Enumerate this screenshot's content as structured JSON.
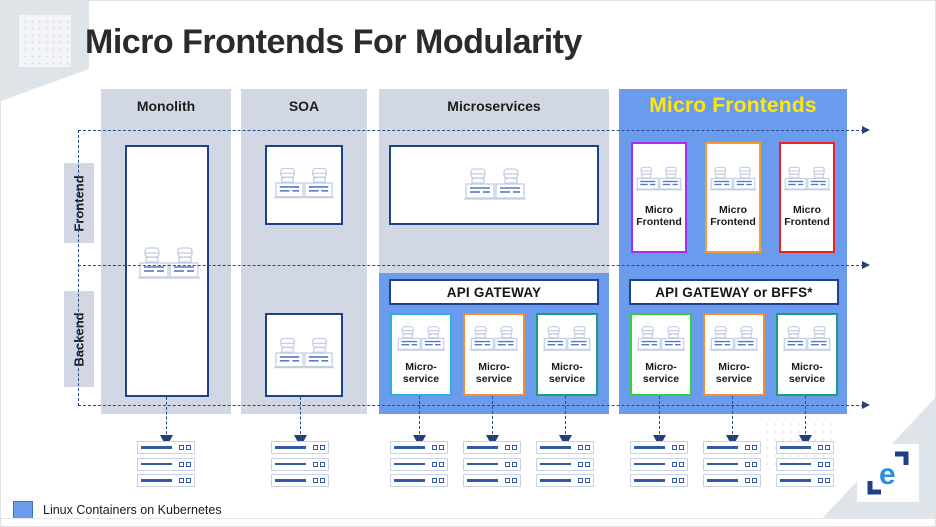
{
  "slide": {
    "title": "Micro Frontends For Modularity",
    "logo_name": "e-logo"
  },
  "bands": [
    {
      "label": "Frontend"
    },
    {
      "label": "Backend"
    }
  ],
  "columns": [
    {
      "id": "monolith",
      "header": "Monolith",
      "highlight": false,
      "frontend_boxes": [],
      "gateway": null,
      "services": []
    },
    {
      "id": "soa",
      "header": "SOA",
      "highlight": false,
      "frontend_boxes": [],
      "gateway": null,
      "services": []
    },
    {
      "id": "microservices",
      "header": "Microservices",
      "highlight": false,
      "frontend_boxes": [],
      "gateway": "API GATEWAY",
      "services": [
        {
          "label": "Micro-\nservice",
          "border": "#2ab0e8"
        },
        {
          "label": "Micro-\nservice",
          "border": "#f09030"
        },
        {
          "label": "Micro-\nservice",
          "border": "#1a9e76"
        }
      ]
    },
    {
      "id": "micro-frontends",
      "header": "Micro Frontends",
      "highlight": true,
      "frontend_boxes": [
        {
          "line1": "Micro",
          "line2": "Frontend",
          "border": "#a531f0"
        },
        {
          "line1": "Micro",
          "line2": "Frontend",
          "border": "#f0a030"
        },
        {
          "line1": "Micro",
          "line2": "Frontend",
          "border": "#f02020"
        }
      ],
      "gateway": "API GATEWAY or  BFFS*",
      "services": [
        {
          "label": "Micro-\nservice",
          "border": "#2fd43a"
        },
        {
          "label": "Micro-\nservice",
          "border": "#f09030"
        },
        {
          "line": "",
          "label": "Micro-\nservice",
          "border": "#1a9e76"
        }
      ]
    }
  ],
  "service_label": "Micro-\nservice",
  "micro_frontend_label_l1": "Micro",
  "micro_frontend_label_l2": "Frontend",
  "legend": {
    "text": "Linux Containers on Kubernetes",
    "swatch_color": "#6b9bec"
  },
  "colors": {
    "column_bg": "#d2d8e3",
    "highlight_bg": "#6b9bec",
    "box_border": "#1d4289",
    "title_text": "#2b2b2b",
    "header_highlight_text": "#ffe70d",
    "dashed_line": "#2b4b8f"
  },
  "icons": {
    "people": "people-at-desk-icon",
    "server": "server-stack-icon"
  }
}
